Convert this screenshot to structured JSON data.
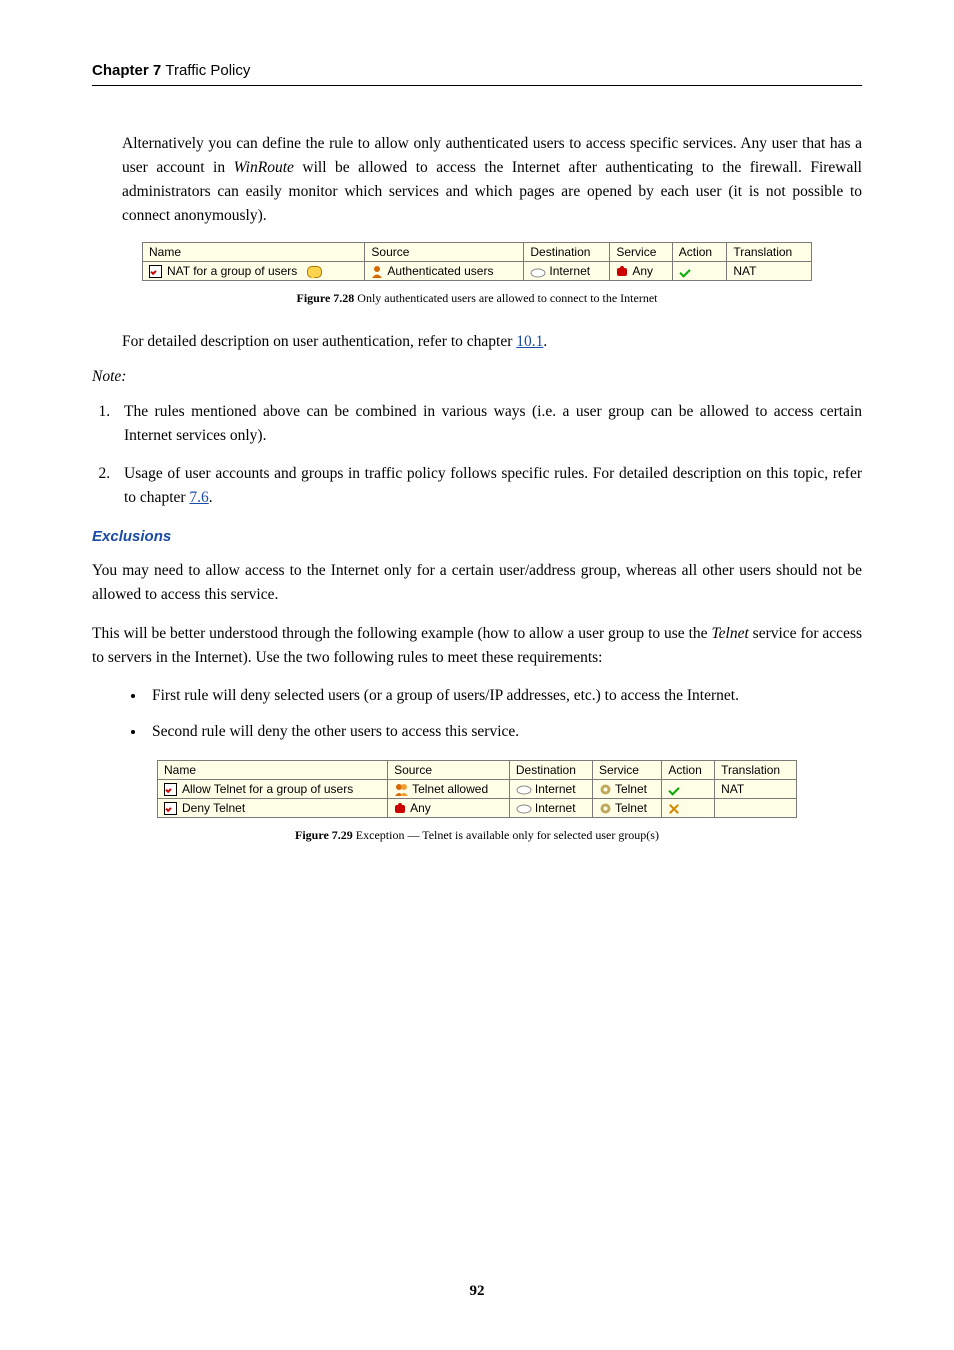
{
  "chapter": {
    "label": "Chapter 7",
    "title": "Traffic Policy"
  },
  "p1": "Alternatively you can define the rule to allow only authenticated users to access specific services.  Any user that has a user account in ",
  "p1_i": "WinRoute",
  "p1b": " will be allowed to access the Internet after authenticating to the firewall.  Firewall administrators can easily monitor which services and which pages are opened by each user (it is not possible to connect anonymously).",
  "fig1": {
    "headers": {
      "name": "Name",
      "source": "Source",
      "dest": "Destination",
      "service": "Service",
      "action": "Action",
      "trans": "Translation"
    },
    "row": {
      "name": "NAT for a group of users",
      "source": "Authenticated users",
      "dest": "Internet",
      "service": "Any",
      "trans": "NAT"
    },
    "caption_b": "Figure 7.28",
    "caption": "   Only authenticated users are allowed to connect to the Internet"
  },
  "p2": "For detailed description on user authentication, refer to chapter ",
  "p2_link": "10.1",
  "p2_tail": ".",
  "note": "Note:",
  "li1": "The rules mentioned above can be combined in various ways (i.e.  a user group can be allowed to access certain Internet services only).",
  "li2": "Usage of user accounts and groups in traffic policy follows specific rules.  For detailed description on this topic, refer to chapter ",
  "li2_link": "7.6",
  "li2_tail": ".",
  "sect": "Exclusions",
  "p3": "You may need to allow access to the Internet only for a certain user/address group, whereas all other users should not be allowed to access this service.",
  "p4a": "This will be better understood through the following example (how to allow a user group to use the ",
  "p4_i": "Telnet",
  "p4b": " service for access to servers in the Internet). Use the two following rules to meet these requirements:",
  "b1": "First rule will deny selected users (or a group of users/IP addresses, etc.) to access the Internet.",
  "b2": "Second rule will deny the other users to access this service.",
  "fig2": {
    "headers": {
      "name": "Name",
      "source": "Source",
      "dest": "Destination",
      "service": "Service",
      "action": "Action",
      "trans": "Translation"
    },
    "rows": [
      {
        "name": "Allow Telnet for a group of users",
        "source": "Telnet allowed",
        "dest": "Internet",
        "service": "Telnet",
        "trans": "NAT"
      },
      {
        "name": "Deny Telnet",
        "source": "Any",
        "dest": "Internet",
        "service": "Telnet",
        "trans": ""
      }
    ],
    "caption_b": "Figure 7.29",
    "caption": "   Exception — Telnet is available only for selected user group(s)"
  },
  "page": "92"
}
